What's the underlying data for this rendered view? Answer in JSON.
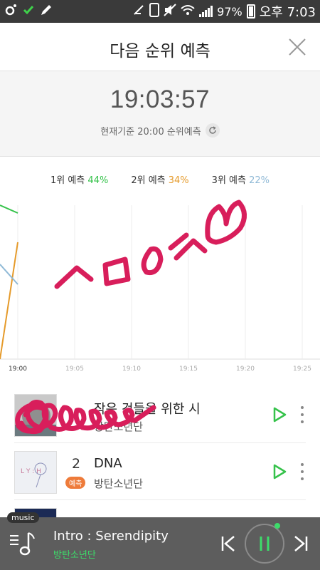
{
  "status_bar": {
    "battery": "97%",
    "time": "오후 7:03",
    "icons": [
      "circle-dot-icon",
      "check-icon",
      "pen-icon",
      "no-notify-icon",
      "phone-icon",
      "mute-icon",
      "wifi-icon",
      "signal-icon",
      "battery-icon"
    ]
  },
  "header": {
    "title": "다음 순위 예측",
    "close_icon": "close-icon"
  },
  "timer": {
    "clock": "19:03:57",
    "basis": "현재기준 20:00 순위예측"
  },
  "legend": [
    {
      "label": "1위 예측",
      "value": "44%",
      "color": "#35c24a"
    },
    {
      "label": "2위 예측",
      "value": "34%",
      "color": "#e59a2a"
    },
    {
      "label": "3위 예측",
      "value": "22%",
      "color": "#8fb9d6"
    }
  ],
  "chart_data": {
    "type": "line",
    "x": [
      "19:00",
      "19:05",
      "19:10",
      "19:15",
      "19:20",
      "19:25"
    ],
    "series": [
      {
        "name": "1위 예측",
        "color": "#35c24a",
        "values": [
          44
        ]
      },
      {
        "name": "2위 예측",
        "color": "#e59a2a",
        "values": [
          34
        ]
      },
      {
        "name": "3위 예측",
        "color": "#8fb9d6",
        "values": [
          22
        ]
      }
    ],
    "grid": true
  },
  "list": [
    {
      "rank": "",
      "song": "작은 것들을 위한 시",
      "artist": "방탄소년단",
      "badge": "",
      "cover": "cover-1"
    },
    {
      "rank": "2",
      "song": "DNA",
      "artist": "방탄소년단",
      "badge": "예측",
      "cover": "cover-2"
    }
  ],
  "player": {
    "tag": "music",
    "track": "Intro : Serendipity",
    "artist": "방탄소년단"
  },
  "colors": {
    "accent_green": "#35c24a",
    "accent_orange": "#ee7b3a",
    "scribble": "#d81e5b"
  }
}
